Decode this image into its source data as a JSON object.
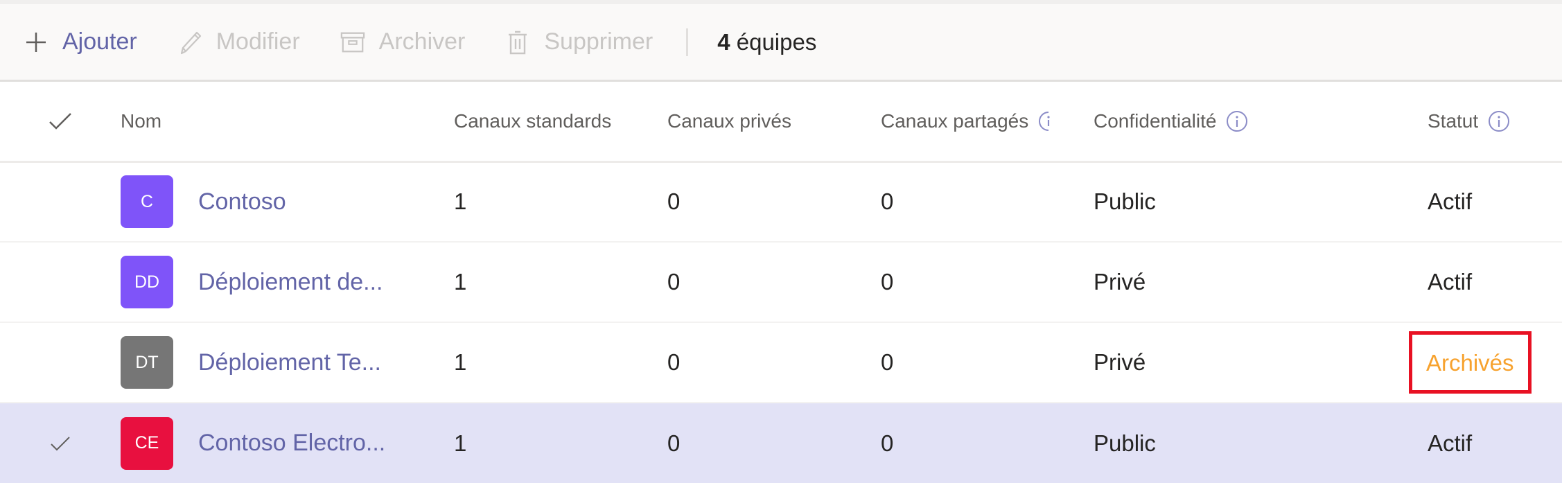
{
  "toolbar": {
    "add_label": "Ajouter",
    "edit_label": "Modifier",
    "archive_label": "Archiver",
    "delete_label": "Supprimer",
    "count_number": "4",
    "count_label": "équipes"
  },
  "table": {
    "columns": {
      "name": "Nom",
      "standard": "Canaux standards",
      "private": "Canaux privés",
      "shared": "Canaux partagés",
      "privacy": "Confidentialité",
      "status": "Statut"
    },
    "rows": [
      {
        "initials": "C",
        "color": "#7f54f9",
        "name": "Contoso",
        "standard": "1",
        "private": "0",
        "shared": "0",
        "privacy": "Public",
        "status": "Actif",
        "selected": false
      },
      {
        "initials": "DD",
        "color": "#7f54f9",
        "name": "Déploiement de...",
        "standard": "1",
        "private": "0",
        "shared": "0",
        "privacy": "Privé",
        "status": "Actif",
        "selected": false
      },
      {
        "initials": "DT",
        "color": "#767676",
        "name": "Déploiement Te...",
        "standard": "1",
        "private": "0",
        "shared": "0",
        "privacy": "Privé",
        "status": "Archivés",
        "selected": false
      },
      {
        "initials": "CE",
        "color": "#e8103f",
        "name": "Contoso Electro...",
        "standard": "1",
        "private": "0",
        "shared": "0",
        "privacy": "Public",
        "status": "Actif",
        "selected": true
      }
    ]
  },
  "colors": {
    "accent": "#6264a7",
    "archived": "#f7a22e",
    "highlight_box": "#e81123",
    "selected_row": "#e2e2f6"
  }
}
